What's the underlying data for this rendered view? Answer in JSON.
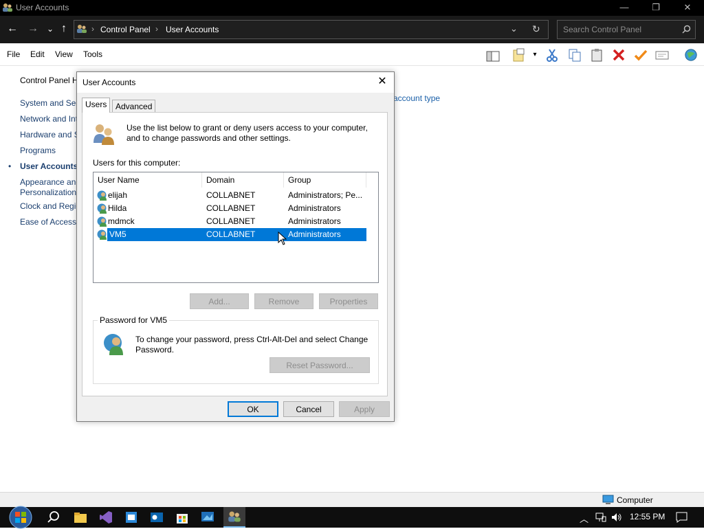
{
  "window": {
    "title": "User Accounts",
    "minimize": "—",
    "restore": "❐",
    "close": "✕"
  },
  "nav": {
    "back": "←",
    "forward": "→",
    "recent": "⌄",
    "up": "↑",
    "breadcrumbs": [
      "Control Panel",
      "User Accounts"
    ],
    "search_placeholder": "Search Control Panel",
    "refresh": "↻",
    "dropdown": "⌄"
  },
  "menubar": {
    "items": [
      "File",
      "Edit",
      "View",
      "Tools"
    ]
  },
  "sidebar": {
    "items": [
      {
        "label": "Control Panel H",
        "active": false
      },
      {
        "label": "System and Sec",
        "active": false
      },
      {
        "label": "Network and Int",
        "active": false
      },
      {
        "label": "Hardware and S",
        "active": false
      },
      {
        "label": "Programs",
        "active": false
      },
      {
        "label": "User Accounts",
        "active": true
      },
      {
        "label": "Appearance and",
        "active": false
      },
      {
        "label": "Personalization",
        "active": false
      },
      {
        "label": "Clock and Regio",
        "active": false
      },
      {
        "label": "Ease of Access",
        "active": false
      }
    ]
  },
  "main": {
    "link_text": "account type"
  },
  "dialog": {
    "title": "User Accounts",
    "close": "✕",
    "tabs": [
      "Users",
      "Advanced"
    ],
    "intro_line1": "Use the list below to grant or deny users access to your computer,",
    "intro_line2": "and to change passwords and other settings.",
    "list_label": "Users for this computer:",
    "columns": [
      "User Name",
      "Domain",
      "Group"
    ],
    "rows": [
      {
        "name": "elijah",
        "domain": "COLLABNET",
        "group": "Administrators; Pe..."
      },
      {
        "name": "Hilda",
        "domain": "COLLABNET",
        "group": "Administrators"
      },
      {
        "name": "mdmck",
        "domain": "COLLABNET",
        "group": "Administrators"
      },
      {
        "name": "VM5",
        "domain": "COLLABNET",
        "group": "Administrators"
      }
    ],
    "selected_row": 3,
    "buttons": {
      "add": "Add...",
      "remove": "Remove",
      "properties": "Properties"
    },
    "password_group": "Password for VM5",
    "password_line1": "To change your password, press Ctrl-Alt-Del and select Change",
    "password_line2": "Password.",
    "reset_password": "Reset Password...",
    "ok": "OK",
    "cancel": "Cancel",
    "apply": "Apply"
  },
  "statusbar": {
    "computer": "Computer"
  },
  "taskbar": {
    "time": "12:55 PM"
  },
  "colors": {
    "selection": "#0078d7",
    "link": "#1a5fa8"
  }
}
